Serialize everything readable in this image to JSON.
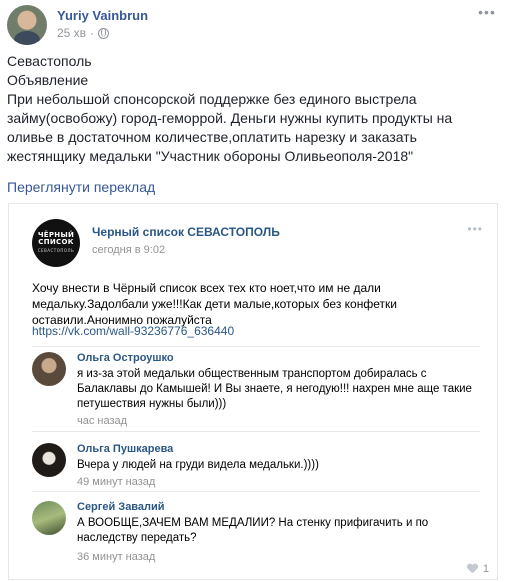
{
  "post": {
    "author": "Yuriy Vainbrun",
    "time": "25 хв",
    "separator": "·",
    "lines": [
      "Севастополь",
      "Объявление",
      "При небольшой спонсорской поддержке без единого выстрела займу(освобожу) город-геморрой. Деньги нужны купить продукты на оливье в достаточном количестве,оплатить нарезку и заказать жестянщику медальки \"Участник обороны Оливьеополя-2018\""
    ],
    "translate_link": "Переглянути переклад"
  },
  "vk": {
    "avatar_logo_line1": "ЧЁРНЫЙ",
    "avatar_logo_line2": "СПИСОК",
    "avatar_logo_sub": "СЕВАСТОПОЛЬ",
    "group_name": "Черный список СЕВАСТОПОЛЬ",
    "date": "сегодня в 9:02",
    "text": "Хочу внести в Чёрный список всех тех кто ноет,что им не дали медальку.Задолбали уже!!!Как дети малые,которых без конфетки оставили.Анонимно пожалуйста",
    "link": "https://vk.com/wall-93236776_636440",
    "comments": [
      {
        "name": "Ольга Остроушко",
        "text": "я из-за этой медальки общественным транспортом добиралась с Балаклавы до Камышей! И Вы знаете, я негодую!!! нахрен мне аще такие петушествия нужны были)))",
        "time": "час назад"
      },
      {
        "name": "Ольга Пушкарева",
        "text": "Вчера у людей на груди видела медальки.))))",
        "time": "49 минут назад"
      },
      {
        "name": "Сергей Завалий",
        "text": "А ВООБЩЕ,ЗАЧЕМ ВАМ МЕДАЛИИ? На стенку прифигачить и по наследству передать?",
        "time": "36 минут назад",
        "likes": "1"
      }
    ]
  },
  "icons": {
    "globe": "globe-icon",
    "more": "more-options-icon",
    "like": "heart-icon"
  },
  "colors": {
    "fb_link": "#365899",
    "vk_link": "#2a5885",
    "muted": "#90949c"
  }
}
